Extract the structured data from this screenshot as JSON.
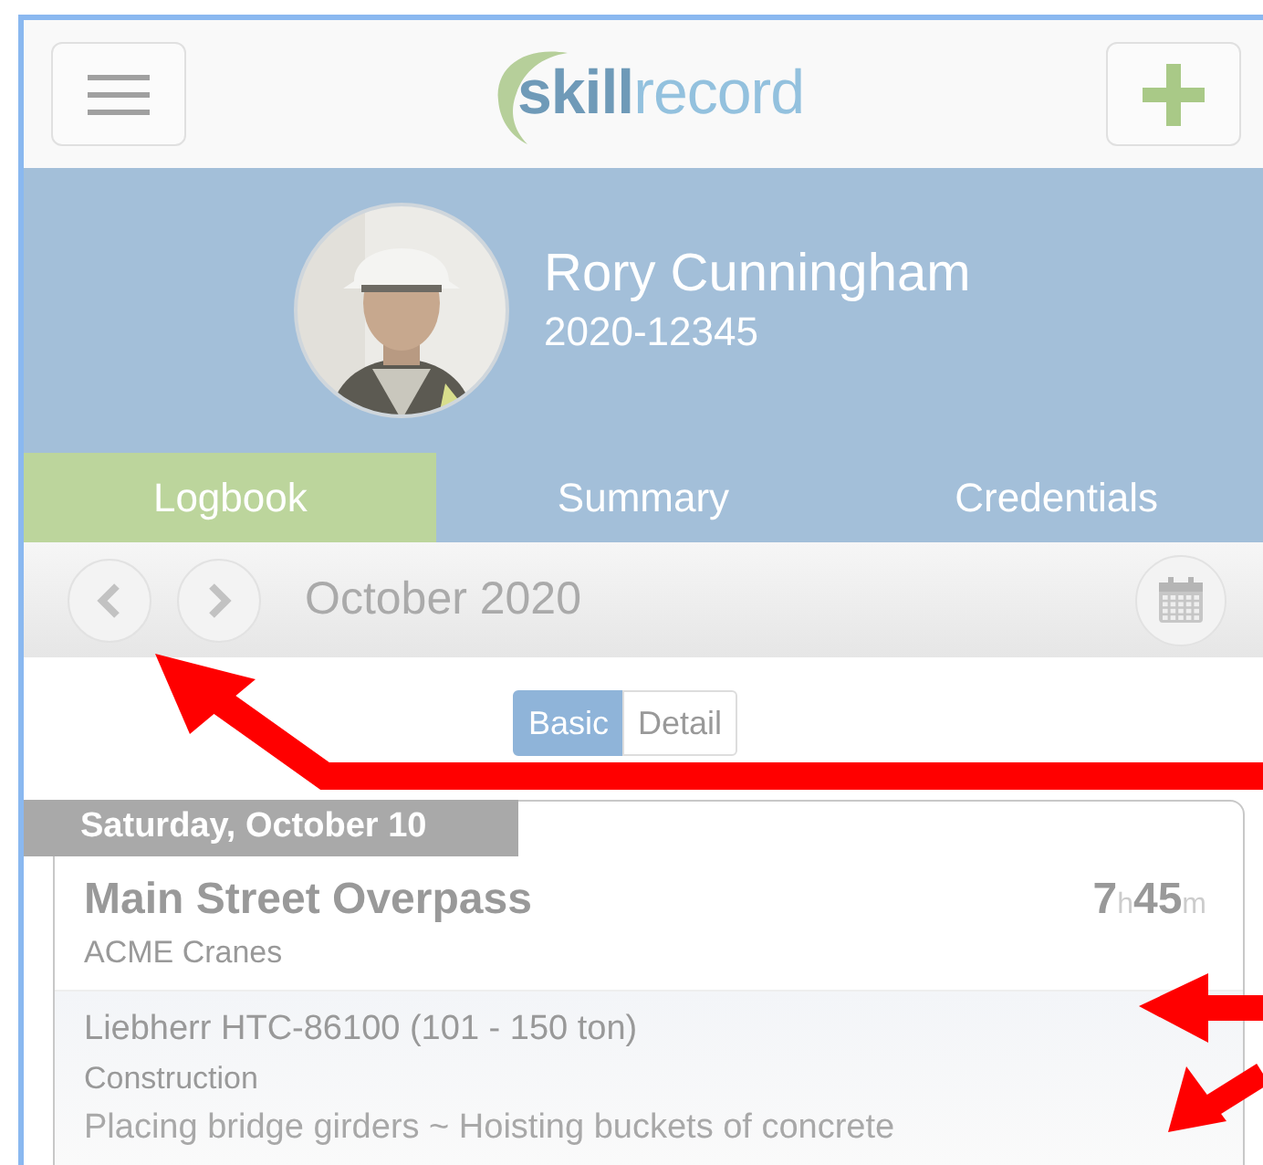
{
  "header": {
    "logo": "**skill**record"
  },
  "profile": {
    "name": "Rory Cunningham",
    "id": "2020-12345"
  },
  "tabs": [
    {
      "label": "Logbook",
      "selected": true
    },
    {
      "label": "Summary",
      "selected": false
    },
    {
      "label": "Credentials",
      "selected": false
    }
  ],
  "month_nav": {
    "label": "October 2020"
  },
  "view_toggle": [
    {
      "label": "Basic",
      "selected": true
    },
    {
      "label": "Detail",
      "selected": false
    }
  ],
  "entries": [
    {
      "date": "Saturday, October 10",
      "title": "Main Street Overpass",
      "company": "ACME Cranes",
      "hours": "7",
      "hours_unit": "h",
      "minutes": "45",
      "minutes_unit": "m",
      "equipment": "Liebherr HTC-86100 (101 - 150 ton)",
      "category": "Construction",
      "description": "Placing bridge girders ~ Hoisting buckets of concrete"
    }
  ],
  "annotations": [
    {
      "kind": "elbow"
    },
    {
      "kind": "left"
    },
    {
      "kind": "down-left"
    }
  ]
}
